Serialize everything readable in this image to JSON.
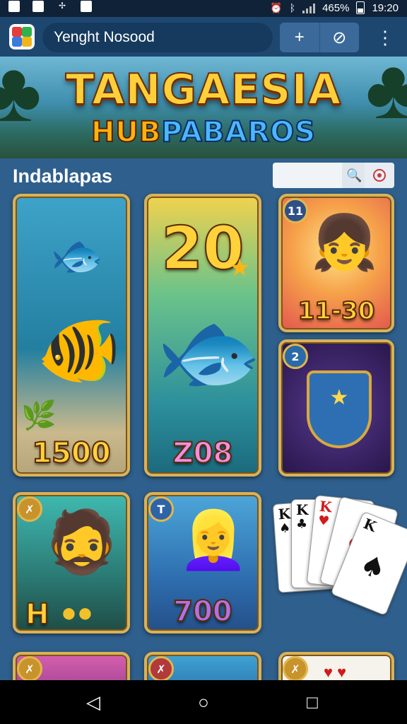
{
  "status_bar": {
    "battery_text": "465%",
    "time": "19:20"
  },
  "app_bar": {
    "search_text": "Yenght Nosood",
    "add_icon": "plus-icon",
    "sync_icon": "circle-arrow-icon",
    "menu_icon": "kebab-menu-icon"
  },
  "banner": {
    "title": "TANGAESIA",
    "subtitle_part1": "HUB",
    "subtitle_part2": "PABAROS"
  },
  "section": {
    "title": "Indablapas",
    "filter_placeholder": ""
  },
  "games": [
    {
      "value": "1500",
      "art": "fish-icon"
    },
    {
      "headline": "20",
      "value": "Z08",
      "art": "fish-icon"
    },
    {
      "badge": "11",
      "value": "11-30",
      "art": "girl-icon"
    },
    {
      "badge": "2",
      "art": "shield-icon"
    },
    {
      "value": "H",
      "art": "man-icon"
    },
    {
      "badge": "T",
      "value": "700",
      "art": "girl-icon"
    },
    {
      "art": "playing-cards-icon"
    }
  ],
  "playing_cards": [
    {
      "rank": "K",
      "suit": "♠",
      "color": "#111111"
    },
    {
      "rank": "K",
      "suit": "♣",
      "color": "#111111"
    },
    {
      "rank": "K",
      "suit": "♥",
      "color": "#d11a1a"
    },
    {
      "rank": "",
      "suit": "♥",
      "color": "#d11a1a"
    },
    {
      "rank": "K",
      "suit": "♠",
      "color": "#111111"
    }
  ],
  "colors": {
    "background": "#2f5f8c",
    "app_bar": "#1e4770",
    "card_border": "#d8b25a"
  },
  "nav_bar": {
    "back_icon": "back-triangle-icon",
    "home_icon": "home-circle-icon",
    "recents_icon": "recents-square-icon"
  }
}
